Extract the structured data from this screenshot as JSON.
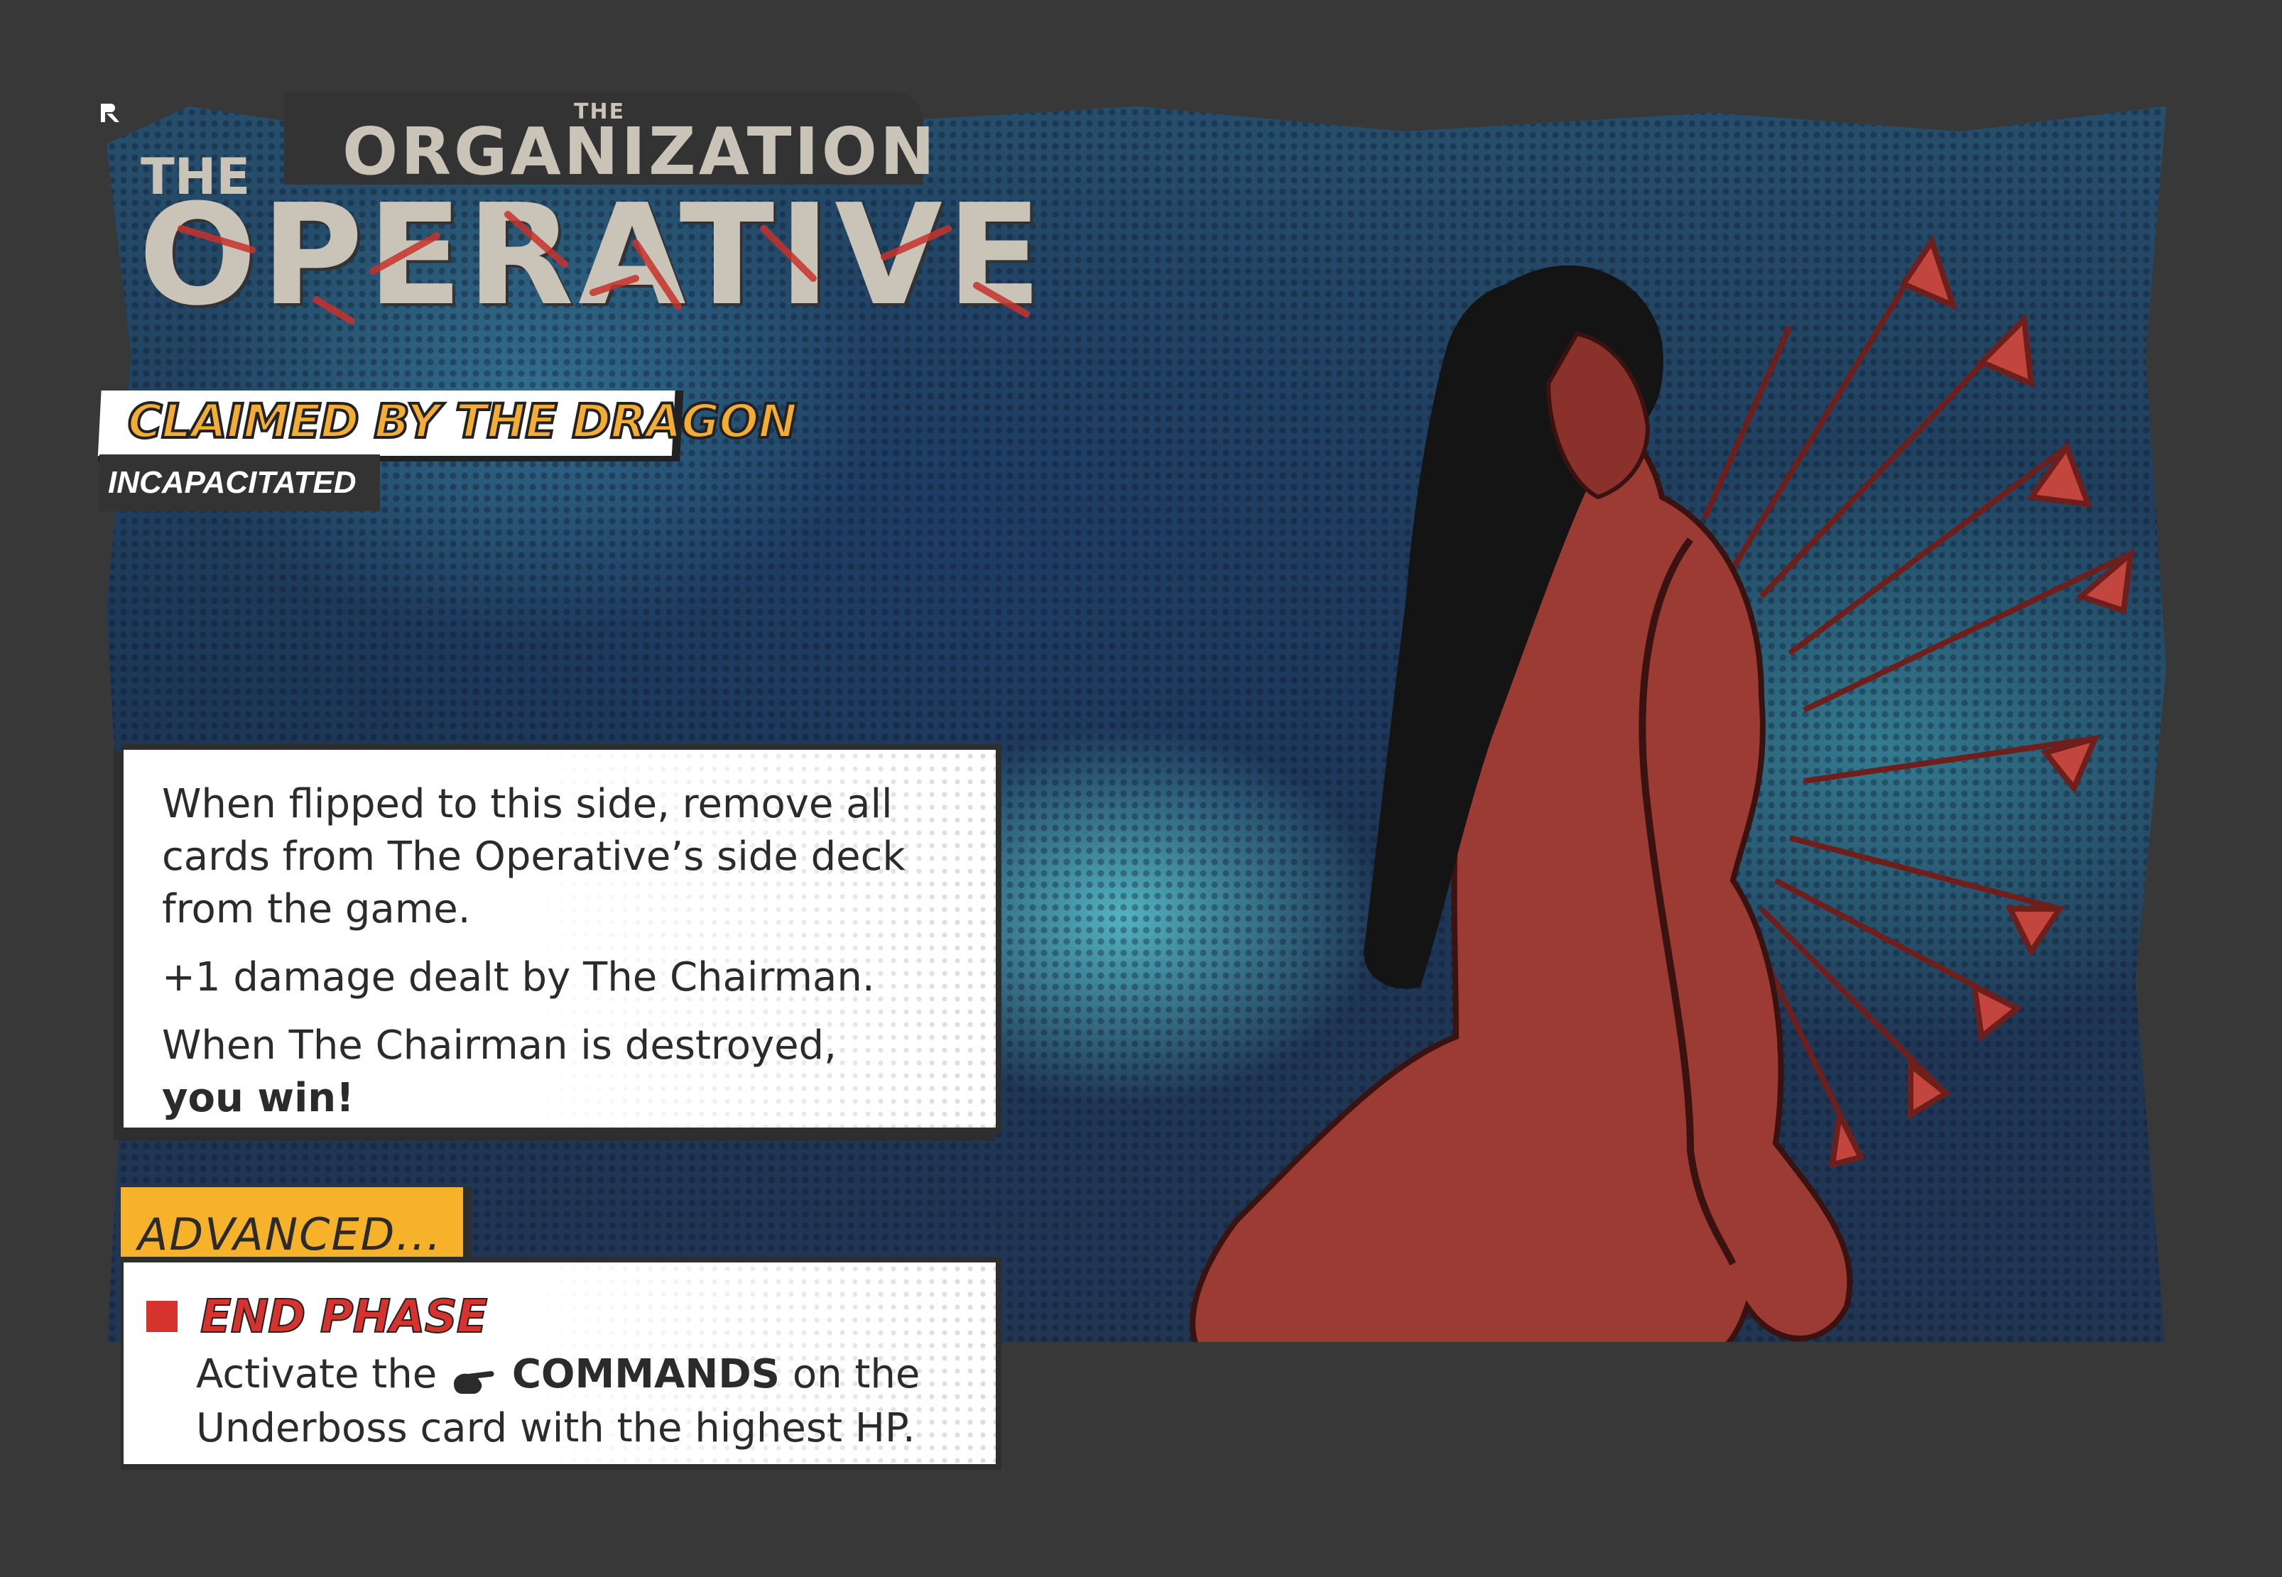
{
  "card": {
    "faction_prefix": "THE",
    "faction": "ORGANIZATION",
    "title_prefix": "THE",
    "title": "OPERATIVE",
    "status_banner": "CLAIMED BY THE DRAGON",
    "status_sub": "INCAPACITATED",
    "logo_icon": "publisher-logo-icon"
  },
  "rules": {
    "line1": "When flipped to this side, remove all cards from The Operative’s side deck from the game.",
    "line2": "+1 damage dealt by The Chairman.",
    "line3_prefix": "When The Chairman is destroyed,",
    "line3_bold": "you win!"
  },
  "advanced": {
    "label": "ADVANCED...",
    "phase_title": "END PHASE",
    "text_prefix": "Activate the",
    "command_icon": "pointing-hand-icon",
    "command_word": "COMMANDS",
    "text_mid": "on the",
    "text_suffix": "Underboss card with the highest HP."
  },
  "colors": {
    "background": "#383838",
    "banner_orange": "#f3ad34",
    "advanced_tab": "#f5b22a",
    "phase_red": "#d6322e",
    "title_grey": "#c9c3b8",
    "figure_red": "#9c3a34"
  }
}
